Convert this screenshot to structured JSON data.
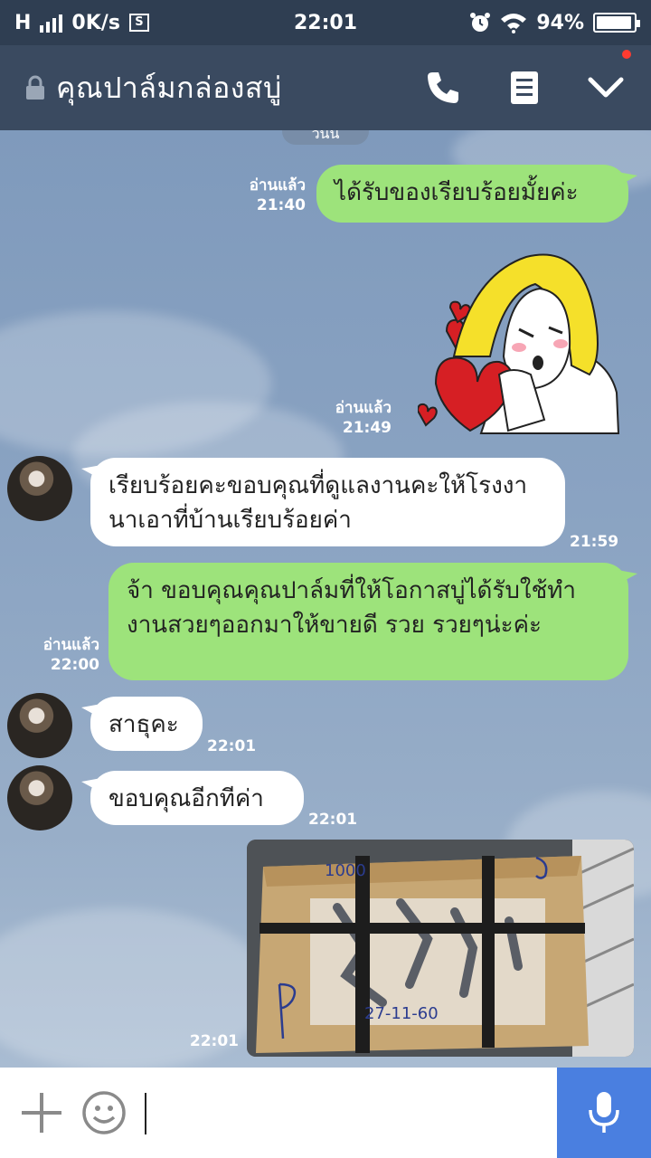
{
  "status_bar": {
    "network": "H",
    "speed": "0K/s",
    "sim_label": "S",
    "time": "22:01",
    "battery": "94%",
    "battery_level": 0.94
  },
  "header": {
    "title": "คุณปาล์มกล่องสบู่"
  },
  "chat": {
    "date_divider": "วันนี้",
    "messages": [
      {
        "side": "out",
        "text": "ได้รับของเรียบร้อยมั้ยค่ะ",
        "read": "อ่านแล้ว",
        "time": "21:40"
      },
      {
        "side": "out",
        "type": "sticker",
        "read": "อ่านแล้ว",
        "time": "21:49"
      },
      {
        "side": "in",
        "text": "เรียบร้อยคะขอบคุณที่ดูแลงานคะให้โรงงานาเอาที่บ้านเรียบร้อยค่า",
        "time": "21:59"
      },
      {
        "side": "out",
        "text": "จ้า  ขอบคุณคุณปาล์มที่ให้โอกาสบู่ได้รับใช้ทำงานสวยๆออกมาให้ขายดี  รวย รวยๆน่ะค่ะ",
        "read": "อ่านแล้ว",
        "time": "22:00"
      },
      {
        "side": "in",
        "text": "สาธุคะ",
        "time": "22:01"
      },
      {
        "side": "in",
        "text": "ขอบคุณอีกทีค่า",
        "time": "22:01"
      },
      {
        "side": "out",
        "type": "photo",
        "time": "22:01",
        "photo_text_top": "1000",
        "photo_text_bottom": "27-11-60"
      }
    ]
  },
  "input": {
    "placeholder": ""
  },
  "icons": {
    "lock": "lock-icon",
    "call": "phone-icon",
    "notes": "notes-icon",
    "menu": "chevron-down-icon",
    "plus": "plus-icon",
    "emoji": "emoji-icon",
    "mic": "microphone-icon"
  },
  "colors": {
    "header_bg": "#3a4a60",
    "status_bg": "#2f3e52",
    "outgoing_bubble": "#9de37b",
    "incoming_bubble": "#ffffff",
    "mic_button": "#4a7fe0",
    "notification_dot": "#ff3b30"
  }
}
